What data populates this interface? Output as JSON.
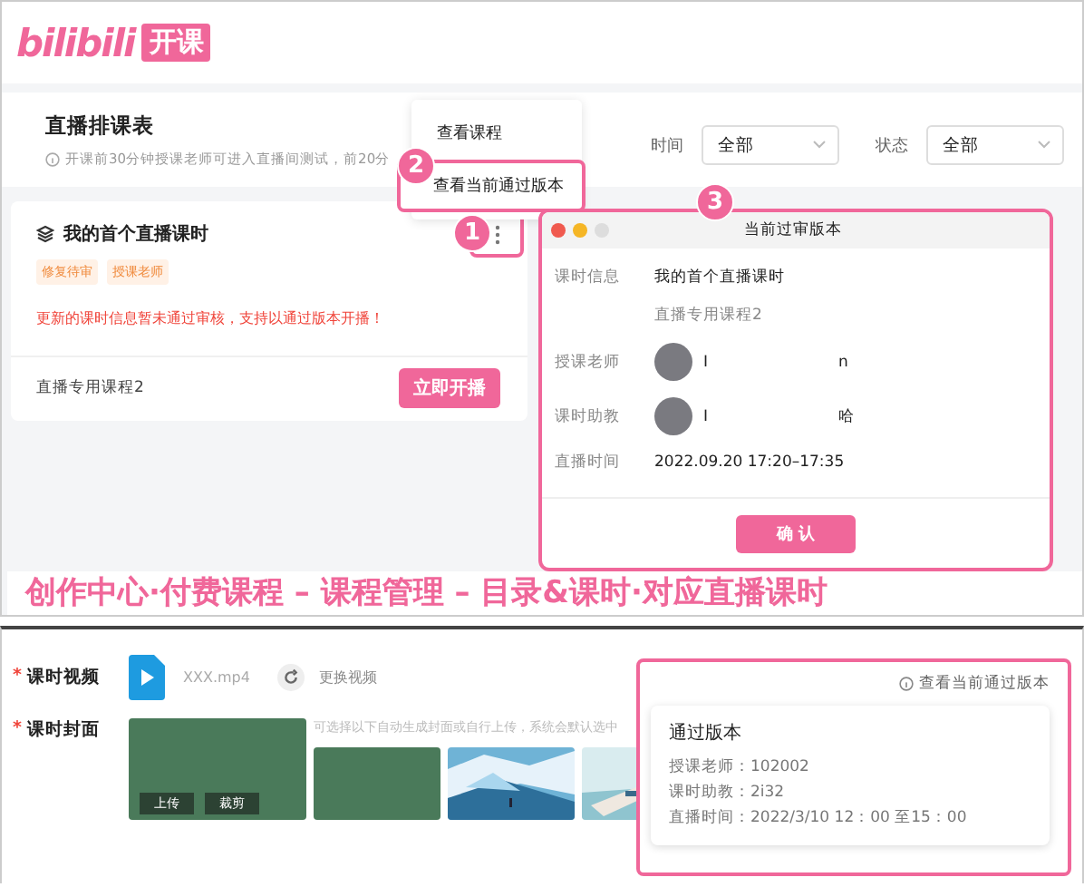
{
  "header": {
    "logo": "bilibili",
    "badge": "开课"
  },
  "schedule": {
    "title": "直播排课表",
    "hint": "开课前30分钟授课老师可进入直播间测试，前20分",
    "filters": [
      {
        "label": "时间",
        "value": "全部"
      },
      {
        "label": "状态",
        "value": "全部"
      }
    ]
  },
  "menu": {
    "items": [
      {
        "label": "查看课程",
        "selected": false
      },
      {
        "label": "查看当前通过版本",
        "selected": true
      }
    ]
  },
  "lesson_card": {
    "title": "我的首个直播课时",
    "tags": [
      "修复待审",
      "授课老师"
    ],
    "warning": "更新的课时信息暂未通过审核，支持以通过版本开播！",
    "course": "直播专用课程2",
    "button": "立即开播"
  },
  "dialog": {
    "title": "当前过审版本",
    "rows": [
      {
        "kind": "text",
        "label": "课时信息",
        "value": "我的首个直播课时",
        "sub": "直播专用课程2"
      },
      {
        "kind": "person",
        "label": "授课老师",
        "name_parts": [
          "I",
          "n"
        ]
      },
      {
        "kind": "person",
        "label": "课时助教",
        "name_parts": [
          "I",
          "哈"
        ]
      },
      {
        "kind": "text",
        "label": "直播时间",
        "value": "2022.09.20 17:20–17:35"
      }
    ],
    "button": "确 认"
  },
  "annotations": [
    "1",
    "2",
    "3"
  ],
  "caption": "创作中心·付费课程 – 课程管理 – 目录&课时·对应直播课时",
  "lesson_form": {
    "fields": [
      {
        "kind": "video",
        "required_mark": "*",
        "label": "课时视频",
        "file": "XXX.mp4",
        "action": "更换视频"
      },
      {
        "kind": "cover",
        "required_mark": "*",
        "label": "课时封面",
        "upload": "上传",
        "crop": "裁剪",
        "hint": "可选择以下自动生成封面或自行上传，系统会默认选中",
        "thumbnails": [
          {
            "kind": "blank"
          },
          {
            "kind": "picture"
          },
          {
            "kind": "picture"
          }
        ]
      }
    ]
  },
  "version_popover": {
    "link": "查看当前通过版本",
    "title": "通过版本",
    "lines": [
      "授课老师：102002",
      "课时助教：2i32",
      "直播时间：2022/3/10  12：00 至15：00"
    ]
  }
}
